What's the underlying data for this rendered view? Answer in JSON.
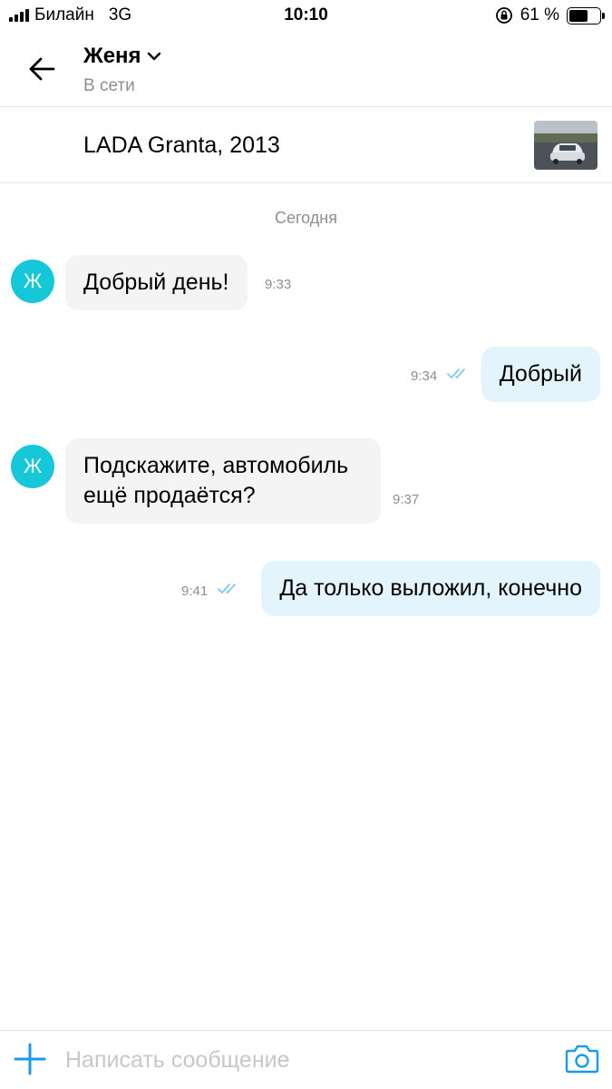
{
  "status_bar": {
    "carrier": "Билайн",
    "network": "3G",
    "time": "10:10",
    "battery": "61 %",
    "battery_level": 0.61
  },
  "header": {
    "contact_name": "Женя",
    "contact_status": "В сети"
  },
  "listing": {
    "title": "LADA Granta, 2013"
  },
  "chat": {
    "date_separator": "Сегодня",
    "avatar_letter": "Ж",
    "messages": [
      {
        "direction": "in",
        "text": "Добрый день!",
        "time": "9:33"
      },
      {
        "direction": "out",
        "text": "Добрый",
        "time": "9:34",
        "read": true
      },
      {
        "direction": "in",
        "text": "Подскажите, автомобиль ещё продаётся?",
        "time": "9:37"
      },
      {
        "direction": "out",
        "text": "Да только выложил, конечно",
        "time": "9:41",
        "read": true
      }
    ]
  },
  "composer": {
    "placeholder": "Написать сообщение"
  },
  "colors": {
    "accent": "#16c7d9",
    "link": "#1a9be8",
    "incoming_bubble": "#f4f4f4",
    "outgoing_bubble": "#e4f4fd",
    "read_ticks": "#7ec8f0"
  }
}
